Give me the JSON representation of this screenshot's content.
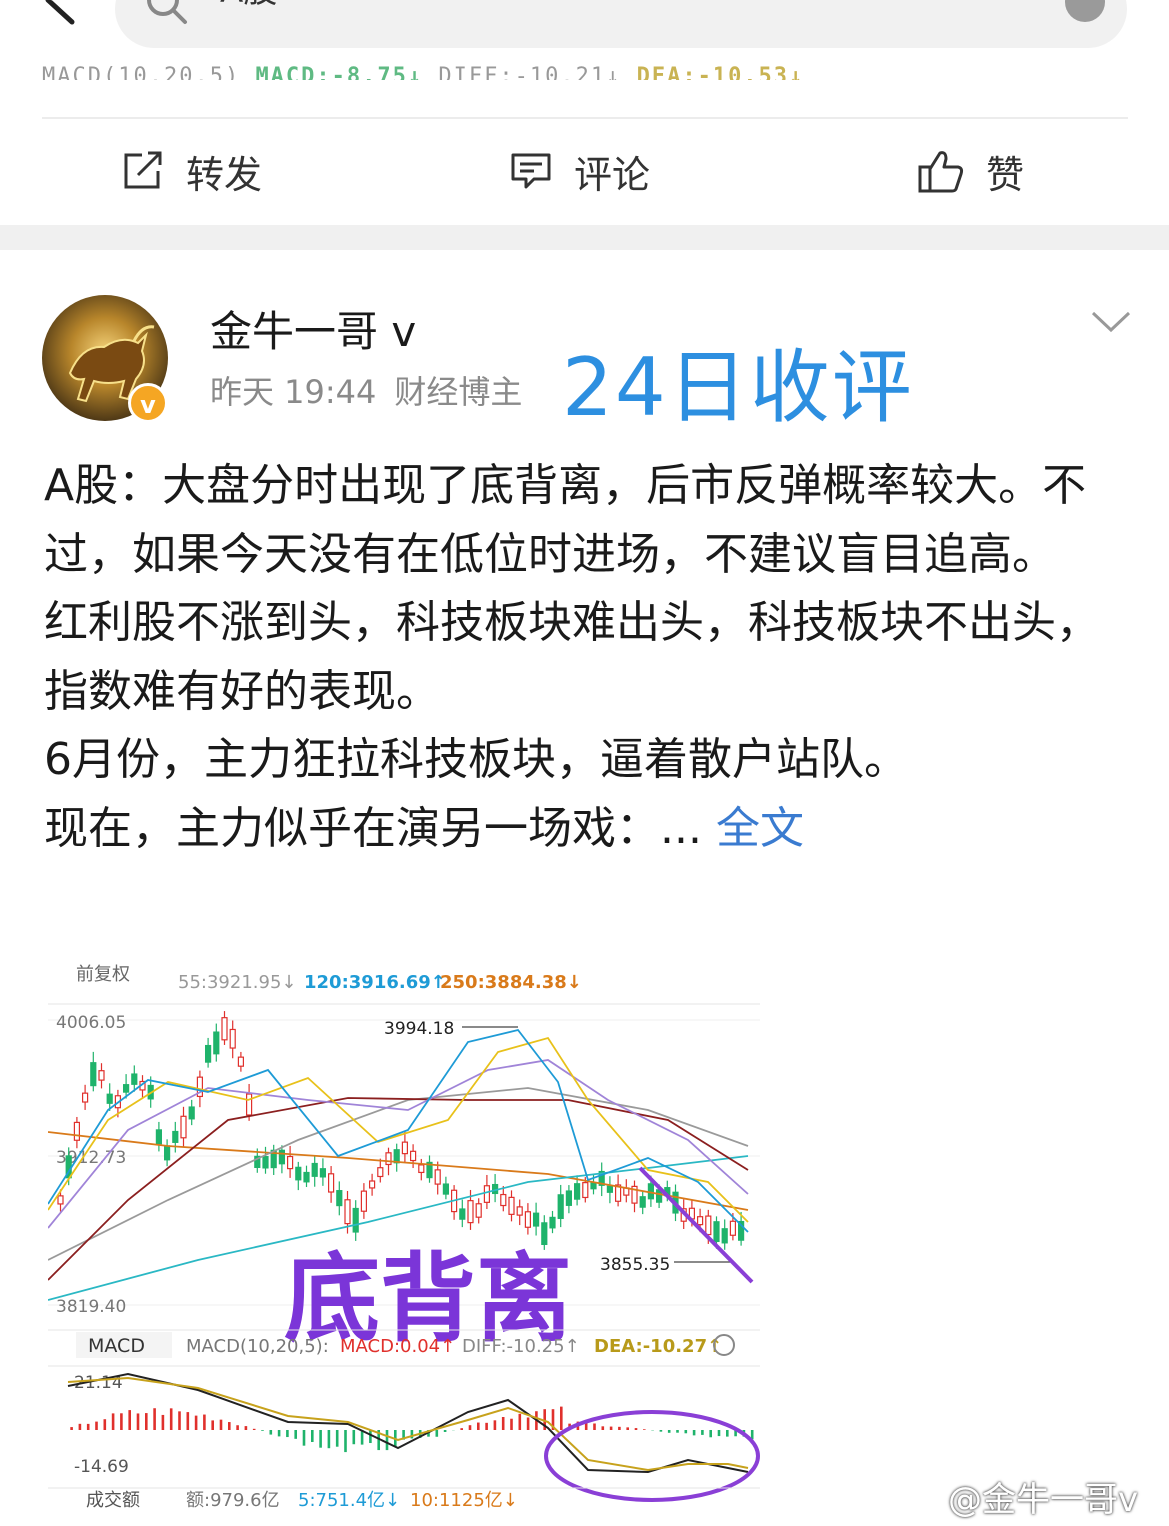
{
  "search": {
    "query": "A股"
  },
  "indicator_strip": {
    "label": "MACD(10,20,5)",
    "macd": "MACD:-8.75↓",
    "diff": "DIFF:-10.21↓",
    "dea": "DEA:-10.53↓"
  },
  "actions": {
    "repost": "转发",
    "comment": "评论",
    "like": "赞"
  },
  "post": {
    "author": "金牛一哥",
    "author_badge": "v",
    "time": "昨天 19:44",
    "role": "财经博主",
    "headline": "24日收评",
    "paragraphs": [
      "A股：大盘分时出现了底背离，后市反弹概率较大。不过，如果今天没有在低位时进场，不建议盲目追高。",
      "红利股不涨到头，科技板块难出头，科技板块不出头，指数难有好的表现。",
      "6月份，主力狂拉科技板块，逼着散户站队。",
      "现在，主力似乎在演另一场戏：..."
    ],
    "more_link": "全文"
  },
  "chart": {
    "adjust_label": "前复权",
    "ma_values": [
      "55:3921.95↓",
      "120:3916.69↑",
      "250:3884.38↓"
    ],
    "high_price_label": "4006.05",
    "mid_price_label": "3912.73",
    "low_price_label": "3819.40",
    "peak_label": "3994.18",
    "trough_label": "3855.35",
    "annotation": "底背离",
    "macd_tab": "MACD",
    "macd_params": "MACD(10,20,5):",
    "macd_value": "MACD:0.04↑",
    "diff_value": "DIFF:-10.25↑",
    "dea_value": "DEA:-10.27↑",
    "macd_high": "21.14",
    "macd_low": "-14.69",
    "volume_tab": "成交额",
    "volume_value": "额:979.6亿",
    "volume_ma5": "5:751.4亿↓",
    "volume_ma10": "10:1125亿↓"
  },
  "watermark": "@金牛一哥v",
  "colors": {
    "link_blue": "#3a7bd0",
    "headline_blue": "#2d8fe0",
    "up_red": "#e0302c",
    "down_green": "#1fb36b",
    "annotation_purple": "#7b35d8",
    "badge_orange": "#f5a623"
  }
}
